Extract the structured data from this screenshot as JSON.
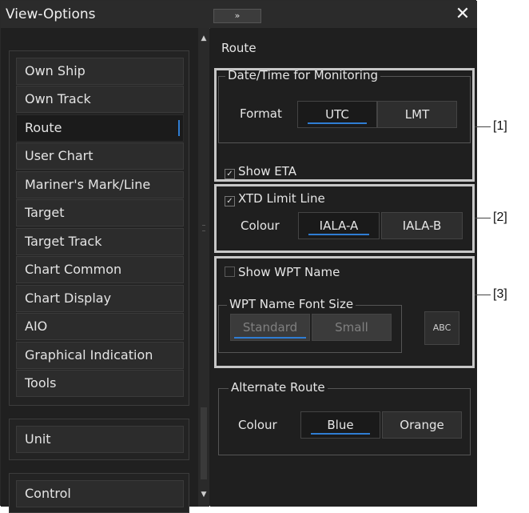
{
  "window": {
    "title": "View-Options",
    "pin_label": "»",
    "close_label": "✕"
  },
  "sidebar": {
    "items": [
      {
        "label": "Own Ship"
      },
      {
        "label": "Own Track"
      },
      {
        "label": "Route",
        "active": true
      },
      {
        "label": "User Chart"
      },
      {
        "label": "Mariner's Mark/Line"
      },
      {
        "label": "Target"
      },
      {
        "label": "Target Track"
      },
      {
        "label": "Chart Common"
      },
      {
        "label": "Chart Display"
      },
      {
        "label": "AIO"
      },
      {
        "label": "Graphical Indication"
      },
      {
        "label": "Tools"
      }
    ],
    "unit_label": "Unit",
    "control_label": "Control"
  },
  "panel": {
    "section_title": "Route",
    "datetime": {
      "legend": "Date/Time for Monitoring",
      "format_label": "Format",
      "options": [
        "UTC",
        "LMT"
      ],
      "selected": "UTC",
      "show_eta_label": "Show ETA",
      "show_eta_checked": true
    },
    "xtd": {
      "label": "XTD Limit Line",
      "checked": true,
      "colour_label": "Colour",
      "options": [
        "IALA-A",
        "IALA-B"
      ],
      "selected": "IALA-A"
    },
    "wpt": {
      "show_name_label": "Show WPT Name",
      "show_name_checked": false,
      "font_legend": "WPT Name Font Size",
      "font_options": [
        "Standard",
        "Small"
      ],
      "font_selected": "Standard",
      "preview_label": "ABC"
    },
    "alternate": {
      "legend": "Alternate Route",
      "colour_label": "Colour",
      "options": [
        "Blue",
        "Orange"
      ],
      "selected": "Blue"
    }
  },
  "callouts": [
    "[1]",
    "[2]",
    "[3]"
  ],
  "colors": {
    "accent": "#2f7dd3",
    "background": "#1f1f1f",
    "callout_border": "#c7c7c7"
  }
}
